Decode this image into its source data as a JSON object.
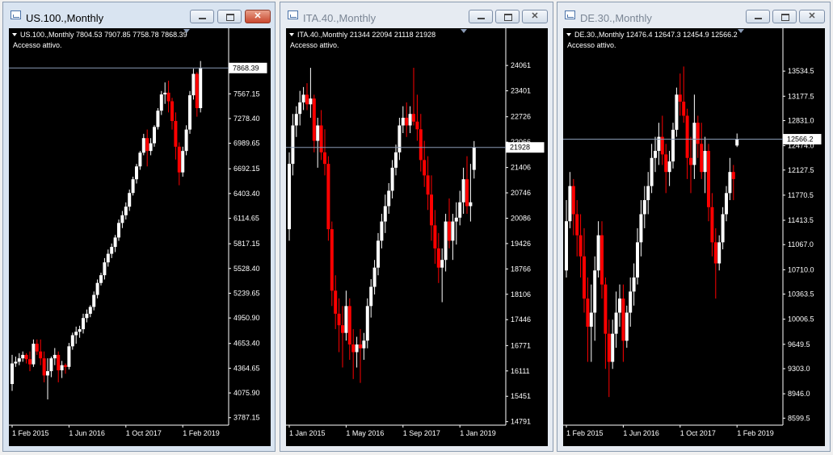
{
  "colors": {
    "bull": "#ffffff",
    "bear": "#ff0000",
    "background": "#000000",
    "grid_line": "#8a9bb5",
    "axis_text": "#ffffff"
  },
  "windows": [
    {
      "title": "US.100.,Monthly",
      "active": true,
      "info_line": "US.100.,Monthly  7804.53 7907.85 7758.78 7868.39",
      "status": "Accesso attivo.",
      "current_price_label": "7868.39",
      "icons": {
        "minimize": "minimize-icon",
        "maximize": "maximize-icon",
        "close": "close-icon",
        "menu": "triangle-down-icon"
      }
    },
    {
      "title": "ITA.40.,Monthly",
      "active": false,
      "info_line": "ITA.40.,Monthly  21344 22094 21118 21928",
      "status": "Accesso attivo.",
      "current_price_label": "21928",
      "icons": {
        "minimize": "minimize-icon",
        "maximize": "maximize-icon",
        "close": "close-icon",
        "menu": "triangle-down-icon"
      }
    },
    {
      "title": "DE.30.,Monthly",
      "active": false,
      "info_line": "DE.30.,Monthly  12476.4 12647.3 12454.9 12566.2",
      "status": "Accesso attivo.",
      "current_price_label": "12566.2",
      "icons": {
        "minimize": "minimize-icon",
        "maximize": "maximize-icon",
        "close": "close-icon",
        "menu": "triangle-down-icon"
      }
    }
  ],
  "chart_data": [
    {
      "type": "candlestick",
      "title": "US.100.,Monthly",
      "ylim": [
        3700,
        8050
      ],
      "y_ticks": [
        "3787.15",
        "4075.90",
        "4364.65",
        "4653.40",
        "4950.90",
        "5239.65",
        "5528.40",
        "5817.15",
        "6114.65",
        "6403.40",
        "6692.15",
        "6989.65",
        "7278.40",
        "7567.15"
      ],
      "x_tick_labels": [
        "1 Feb 2015",
        "1 Jun 2016",
        "1 Oct 2017",
        "1 Feb 2019"
      ],
      "x_tick_index": [
        0,
        16,
        32,
        48
      ],
      "current_price": 7868.39,
      "ohlc": [
        [
          4180,
          4520,
          4100,
          4420
        ],
        [
          4420,
          4500,
          4380,
          4440
        ],
        [
          4440,
          4540,
          4400,
          4480
        ],
        [
          4480,
          4560,
          4440,
          4520
        ],
        [
          4520,
          4540,
          4420,
          4470
        ],
        [
          4470,
          4560,
          4330,
          4410
        ],
        [
          4410,
          4700,
          4380,
          4650
        ],
        [
          4650,
          4700,
          4520,
          4560
        ],
        [
          4560,
          4700,
          4400,
          4480
        ],
        [
          4480,
          4560,
          4200,
          4280
        ],
        [
          4280,
          4480,
          4000,
          4330
        ],
        [
          4330,
          4500,
          4260,
          4480
        ],
        [
          4480,
          4600,
          4400,
          4520
        ],
        [
          4520,
          4560,
          4200,
          4340
        ],
        [
          4340,
          4450,
          4250,
          4400
        ],
        [
          4400,
          4420,
          4300,
          4380
        ],
        [
          4380,
          4660,
          4350,
          4620
        ],
        [
          4620,
          4780,
          4580,
          4750
        ],
        [
          4750,
          4850,
          4650,
          4790
        ],
        [
          4790,
          4860,
          4720,
          4820
        ],
        [
          4820,
          5000,
          4770,
          4950
        ],
        [
          4950,
          5050,
          4900,
          5000
        ],
        [
          5000,
          5100,
          4960,
          5080
        ],
        [
          5080,
          5260,
          5040,
          5220
        ],
        [
          5220,
          5400,
          5180,
          5360
        ],
        [
          5360,
          5480,
          5330,
          5450
        ],
        [
          5450,
          5650,
          5400,
          5600
        ],
        [
          5600,
          5750,
          5550,
          5700
        ],
        [
          5700,
          5820,
          5650,
          5780
        ],
        [
          5780,
          5920,
          5720,
          5890
        ],
        [
          5890,
          6100,
          5850,
          6060
        ],
        [
          6060,
          6200,
          6000,
          6150
        ],
        [
          6150,
          6300,
          6100,
          6250
        ],
        [
          6250,
          6450,
          6200,
          6410
        ],
        [
          6410,
          6600,
          6380,
          6570
        ],
        [
          6570,
          6750,
          6520,
          6720
        ],
        [
          6720,
          6900,
          6680,
          6880
        ],
        [
          6880,
          7100,
          6850,
          7050
        ],
        [
          7050,
          7150,
          6720,
          6900
        ],
        [
          6900,
          7050,
          6850,
          6990
        ],
        [
          6990,
          7200,
          6950,
          7180
        ],
        [
          7180,
          7400,
          7150,
          7370
        ],
        [
          7370,
          7600,
          7320,
          7560
        ],
        [
          7560,
          7700,
          7450,
          7580
        ],
        [
          7580,
          7720,
          7350,
          7480
        ],
        [
          7480,
          7520,
          7150,
          7250
        ],
        [
          7250,
          7350,
          6800,
          6950
        ],
        [
          6950,
          7000,
          6500,
          6650
        ],
        [
          6650,
          6950,
          6600,
          6900
        ],
        [
          6900,
          7200,
          6850,
          7150
        ],
        [
          7150,
          7600,
          7100,
          7550
        ],
        [
          7550,
          7860,
          7500,
          7800
        ],
        [
          7800,
          7820,
          7300,
          7400
        ],
        [
          7400,
          7950,
          7350,
          7868
        ]
      ]
    },
    {
      "type": "candlestick",
      "title": "ITA.40.,Monthly",
      "ylim": [
        14700,
        24400
      ],
      "y_ticks": [
        "14791",
        "15451",
        "16111",
        "16771",
        "17446",
        "18106",
        "18766",
        "19426",
        "20086",
        "20746",
        "21406",
        "22066",
        "22726",
        "23401",
        "24061"
      ],
      "x_tick_labels": [
        "1 Jan 2015",
        "1 May 2016",
        "1 Sep 2017",
        "1 Jan 2019"
      ],
      "x_tick_index": [
        0,
        16,
        32,
        48
      ],
      "current_price": 21928,
      "ohlc": [
        [
          19800,
          21800,
          19500,
          21500
        ],
        [
          21500,
          22800,
          21200,
          22500
        ],
        [
          22500,
          23000,
          22200,
          22800
        ],
        [
          22800,
          23400,
          22500,
          23100
        ],
        [
          23100,
          23500,
          22900,
          23300
        ],
        [
          23300,
          23600,
          22900,
          23050
        ],
        [
          23050,
          24000,
          22700,
          23200
        ],
        [
          23200,
          23300,
          21800,
          22100
        ],
        [
          22100,
          22700,
          21400,
          22500
        ],
        [
          22500,
          22900,
          21600,
          21800
        ],
        [
          21800,
          22400,
          21200,
          21500
        ],
        [
          21500,
          21700,
          19500,
          19800
        ],
        [
          19800,
          20000,
          17800,
          18200
        ],
        [
          18200,
          18600,
          17200,
          17600
        ],
        [
          17600,
          18000,
          16600,
          17300
        ],
        [
          17300,
          17800,
          16200,
          17100
        ],
        [
          17100,
          18200,
          16900,
          17800
        ],
        [
          17800,
          18000,
          16400,
          16800
        ],
        [
          16800,
          17200,
          15900,
          16600
        ],
        [
          16600,
          17000,
          16200,
          16800
        ],
        [
          16800,
          17200,
          15800,
          16700
        ],
        [
          16700,
          17100,
          16400,
          16900
        ],
        [
          16900,
          18000,
          16700,
          17800
        ],
        [
          17800,
          18500,
          17500,
          18300
        ],
        [
          18300,
          19000,
          18100,
          18800
        ],
        [
          18800,
          19700,
          18600,
          19500
        ],
        [
          19500,
          20200,
          19300,
          20000
        ],
        [
          20000,
          20700,
          19700,
          20400
        ],
        [
          20400,
          21000,
          20200,
          20800
        ],
        [
          20800,
          21600,
          20600,
          21400
        ],
        [
          21400,
          22000,
          21200,
          21800
        ],
        [
          21800,
          22700,
          21600,
          22500
        ],
        [
          22500,
          23000,
          22300,
          22700
        ],
        [
          22700,
          23100,
          22200,
          22500
        ],
        [
          22500,
          23000,
          22300,
          22800
        ],
        [
          22800,
          24000,
          22500,
          22600
        ],
        [
          22600,
          23300,
          22100,
          22400
        ],
        [
          22400,
          22800,
          21300,
          21600
        ],
        [
          21600,
          22100,
          20900,
          21200
        ],
        [
          21200,
          21700,
          20300,
          20700
        ],
        [
          20700,
          21200,
          19500,
          19900
        ],
        [
          19900,
          20300,
          18900,
          19300
        ],
        [
          19300,
          19700,
          18400,
          18800
        ],
        [
          18800,
          19300,
          17900,
          19000
        ],
        [
          19000,
          20200,
          18700,
          20000
        ],
        [
          20000,
          20600,
          19300,
          19500
        ],
        [
          19500,
          20200,
          19000,
          20000
        ],
        [
          20000,
          20500,
          19400,
          20100
        ],
        [
          20100,
          20800,
          19900,
          20500
        ],
        [
          20500,
          21400,
          20200,
          21100
        ],
        [
          21100,
          21700,
          20200,
          20400
        ],
        [
          20400,
          21500,
          20000,
          20500
        ],
        [
          21344,
          22094,
          21118,
          21928
        ]
      ]
    },
    {
      "type": "candlestick",
      "title": "DE.30.,Monthly",
      "ylim": [
        8500,
        13800
      ],
      "y_ticks": [
        "8599.5",
        "8946.0",
        "9303.0",
        "9649.5",
        "10006.5",
        "10363.5",
        "10710.0",
        "11067.0",
        "11413.5",
        "11770.5",
        "12127.5",
        "12474.0",
        "12831.0",
        "13177.5",
        "13534.5"
      ],
      "x_tick_labels": [
        "1 Feb 2015",
        "1 Jun 2016",
        "1 Oct 2017",
        "1 Feb 2019"
      ],
      "x_tick_index": [
        0,
        16,
        32,
        48
      ],
      "current_price": 12566.2,
      "ohlc": [
        [
          10700,
          11700,
          10600,
          11400
        ],
        [
          11400,
          12100,
          11300,
          11900
        ],
        [
          11900,
          12000,
          11200,
          11500
        ],
        [
          11500,
          11700,
          10900,
          11200
        ],
        [
          11200,
          11500,
          10600,
          10900
        ],
        [
          10900,
          11300,
          10100,
          10300
        ],
        [
          10300,
          10600,
          9400,
          9900
        ],
        [
          9900,
          10500,
          9400,
          10100
        ],
        [
          10100,
          10900,
          9700,
          10700
        ],
        [
          10700,
          11400,
          10600,
          11200
        ],
        [
          11200,
          11400,
          10300,
          10500
        ],
        [
          10500,
          10600,
          9300,
          9800
        ],
        [
          9800,
          10000,
          8900,
          9400
        ],
        [
          9400,
          10000,
          9300,
          9800
        ],
        [
          9800,
          10400,
          9600,
          10100
        ],
        [
          10100,
          10500,
          9900,
          10300
        ],
        [
          10300,
          10500,
          9400,
          9700
        ],
        [
          9700,
          10200,
          9600,
          10100
        ],
        [
          10100,
          10600,
          9900,
          10400
        ],
        [
          10400,
          10800,
          10200,
          10600
        ],
        [
          10600,
          11300,
          10500,
          11100
        ],
        [
          11100,
          11700,
          10900,
          11500
        ],
        [
          11500,
          11900,
          11300,
          11700
        ],
        [
          11700,
          12100,
          11500,
          11900
        ],
        [
          11900,
          12500,
          11800,
          12300
        ],
        [
          12300,
          12600,
          12100,
          12400
        ],
        [
          12400,
          12800,
          12200,
          12600
        ],
        [
          12600,
          12900,
          12200,
          12350
        ],
        [
          12350,
          12500,
          11800,
          12100
        ],
        [
          12100,
          12400,
          11900,
          12250
        ],
        [
          12250,
          12800,
          12150,
          12700
        ],
        [
          12700,
          13300,
          12600,
          13200
        ],
        [
          13200,
          13500,
          12900,
          13100
        ],
        [
          13100,
          13600,
          12800,
          12900
        ],
        [
          12900,
          13000,
          12000,
          12300
        ],
        [
          12300,
          12600,
          11800,
          12200
        ],
        [
          12200,
          13200,
          12000,
          12800
        ],
        [
          12800,
          12900,
          12300,
          12500
        ],
        [
          12500,
          12800,
          12000,
          12100
        ],
        [
          12100,
          12600,
          11800,
          12400
        ],
        [
          12400,
          12500,
          11400,
          11600
        ],
        [
          11600,
          11800,
          10900,
          11100
        ],
        [
          11100,
          11300,
          10300,
          10800
        ],
        [
          10800,
          11200,
          10700,
          11100
        ],
        [
          11100,
          11600,
          11000,
          11500
        ],
        [
          11500,
          11900,
          11400,
          11800
        ],
        [
          11800,
          12300,
          11700,
          12100
        ],
        [
          12100,
          12200,
          11700,
          12000
        ],
        [
          12476.4,
          12647.3,
          12454.9,
          12566.2
        ]
      ]
    }
  ]
}
